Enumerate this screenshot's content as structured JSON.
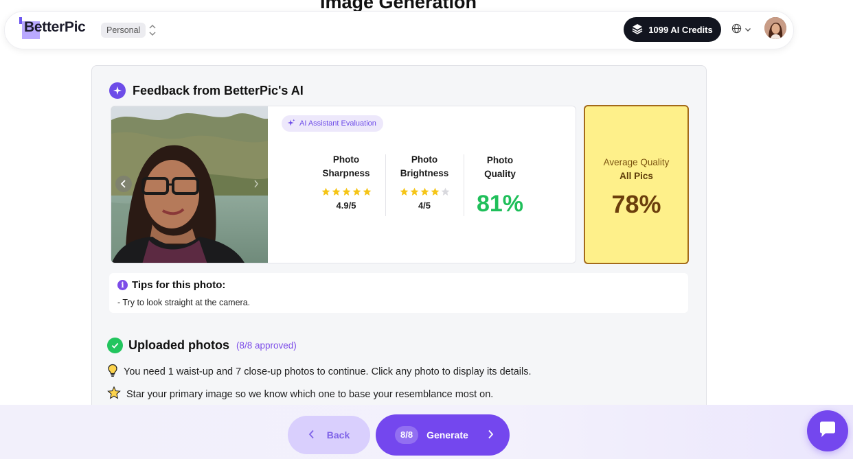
{
  "page": {
    "heading": "Image Generation"
  },
  "topbar": {
    "logo_text": "BetterPic",
    "plan_label": "Personal",
    "credits_label": "1099 AI Credits"
  },
  "feedback": {
    "title": "Feedback from BetterPic's AI",
    "badge": "AI Assistant Evaluation",
    "metrics": {
      "sharpness": {
        "label_line1": "Photo",
        "label_line2": "Sharpness",
        "score": "4.9/5",
        "stars": 5
      },
      "brightness": {
        "label_line1": "Photo",
        "label_line2": "Brightness",
        "score": "4/5",
        "stars": 4
      },
      "quality": {
        "label_line1": "Photo",
        "label_line2": "Quality",
        "value": "81%"
      }
    },
    "average": {
      "label_line1": "Average Quality",
      "label_line2": "All Pics",
      "value": "78%"
    }
  },
  "tips": {
    "title": "Tips for this photo:",
    "text": "- Try to look straight at the camera."
  },
  "uploaded": {
    "title": "Uploaded photos",
    "count": "(8/8 approved)",
    "instruction_1": "You need 1 waist-up and 7 close-up photos to continue. Click any photo to display its details.",
    "instruction_2": "Star your primary image so we know which one to base your resemblance most on."
  },
  "footer": {
    "back_label": "Back",
    "generate_count": "8/8",
    "generate_label": "Generate"
  },
  "colors": {
    "accent": "#7447ee",
    "quality_green": "#1fbf5a",
    "average_bg": "#fef08a",
    "star_gold": "#f5c518"
  },
  "icons": [
    "layers-icon",
    "globe-icon",
    "chevron-down-icon",
    "sparkle-icon",
    "info-icon",
    "check-icon",
    "lightbulb-icon",
    "star-icon",
    "chevron-left-icon",
    "chevron-right-icon",
    "chat-icon"
  ]
}
